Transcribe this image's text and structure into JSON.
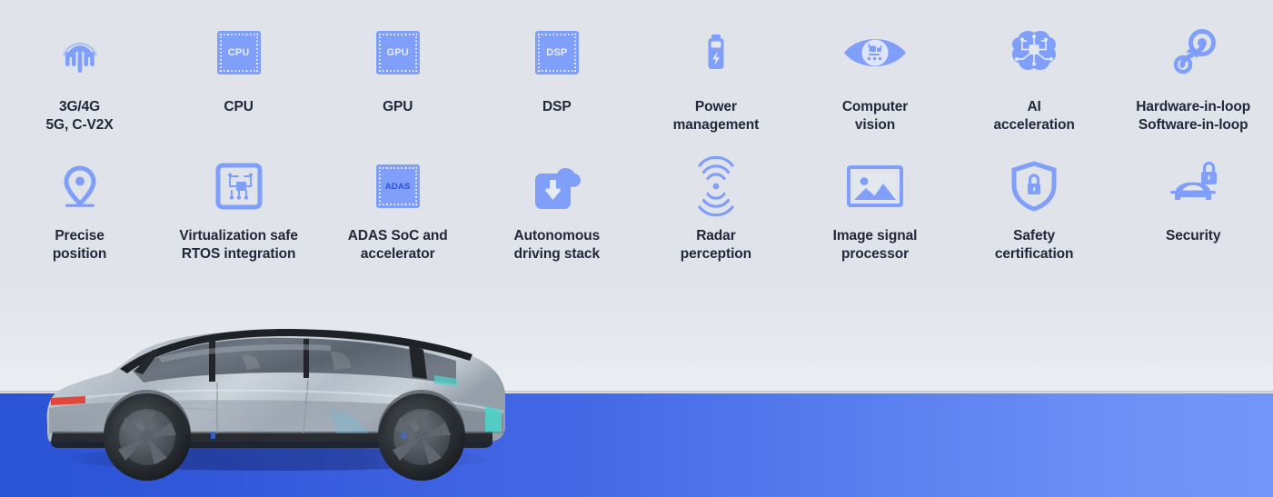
{
  "theme": {
    "background": "#dfe3ea",
    "band_blue_left": "#2a53d6",
    "band_blue_right": "#7296f7",
    "icon_blue": "#7f9ffa",
    "icon_blue_light": "#9ab4fb",
    "text_color": "#22273a",
    "chip_label_color": "#e8eefe",
    "adas_label_color": "#2b50d8"
  },
  "grid": {
    "rows": [
      {
        "row": 1,
        "items": [
          {
            "icon": "signal-antenna-5g-icon",
            "label": "3G/4G\n5G, C-V2X"
          },
          {
            "icon": "cpu-chip-icon",
            "chip_text": "CPU",
            "label": "CPU"
          },
          {
            "icon": "gpu-chip-icon",
            "chip_text": "GPU",
            "label": "GPU"
          },
          {
            "icon": "dsp-chip-icon",
            "chip_text": "DSP",
            "label": "DSP"
          },
          {
            "icon": "battery-bolt-icon",
            "label": "Power\nmanagement"
          },
          {
            "icon": "eye-vision-chip-icon",
            "label": "Computer\nvision"
          },
          {
            "icon": "brain-circuit-icon",
            "label": "AI\nacceleration"
          },
          {
            "icon": "loop-arrows-icon",
            "label": "Hardware-in-loop\nSoftware-in-loop"
          }
        ]
      },
      {
        "row": 2,
        "items": [
          {
            "icon": "map-pin-icon",
            "label": "Precise\nposition"
          },
          {
            "icon": "virtualization-frame-circuit-icon",
            "label": "Virtualization safe\nRTOS integration"
          },
          {
            "icon": "adas-chip-icon",
            "chip_text": "ADAS",
            "label": "ADAS SoC and\naccelerator"
          },
          {
            "icon": "cloud-download-icon",
            "label": "Autonomous\ndriving stack"
          },
          {
            "icon": "radar-waves-icon",
            "label": "Radar\nperception"
          },
          {
            "icon": "image-photo-icon",
            "label": "Image signal\nprocessor"
          },
          {
            "icon": "shield-lock-icon",
            "label": "Safety\ncertification"
          },
          {
            "icon": "car-lock-icon",
            "label": "Security"
          }
        ]
      }
    ]
  },
  "hero": {
    "vehicle_name": "concept-suv-side-view",
    "body_color": "#b6bfc8",
    "glass_color": "#5e6671",
    "accent_teal": "#4fd3c8",
    "taillight_color": "#e0483a"
  }
}
